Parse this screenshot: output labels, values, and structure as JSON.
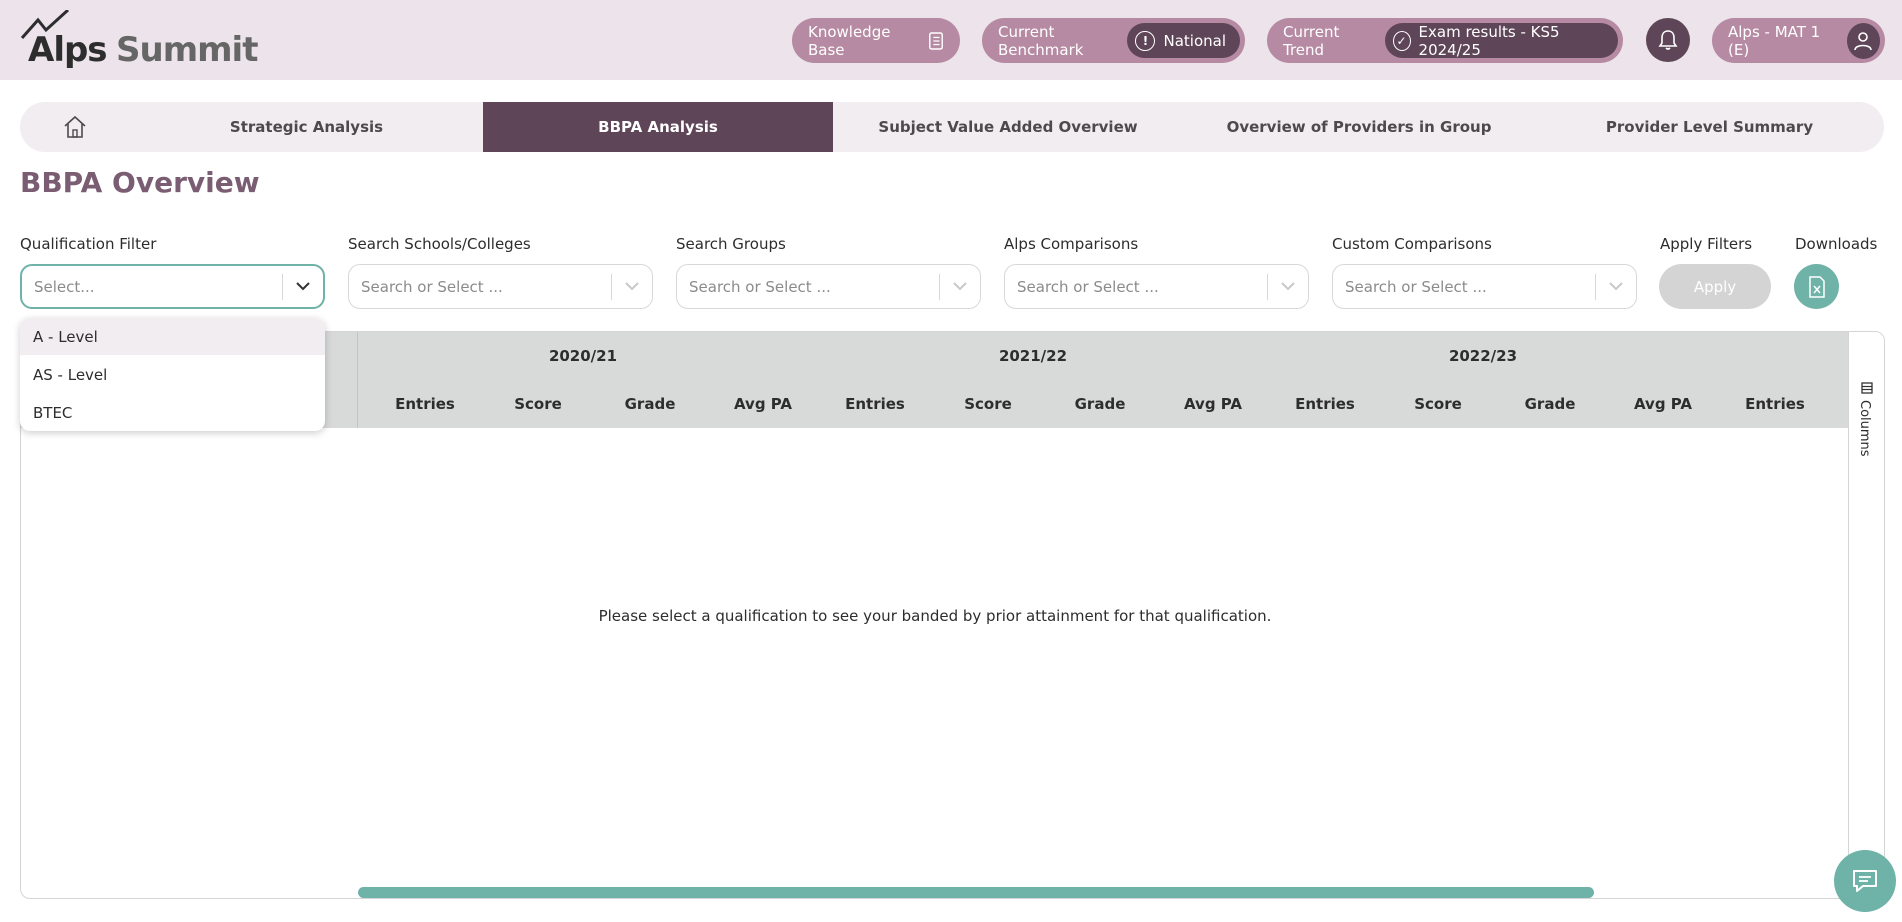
{
  "header": {
    "logo_text_1": "Alps",
    "logo_text_2": "Summit",
    "knowledge_base": "Knowledge Base",
    "benchmark_label": "Current Benchmark",
    "benchmark_value": "National",
    "trend_label": "Current Trend",
    "trend_value": "Exam results - KS5 2024/25",
    "account": "Alps - MAT 1 (E)"
  },
  "nav": {
    "tabs": [
      "Strategic Analysis",
      "BBPA Analysis",
      "Subject Value Added Overview",
      "Overview of Providers in Group",
      "Provider Level Summary"
    ],
    "active": "BBPA Analysis"
  },
  "page": {
    "title": "BBPA Overview"
  },
  "filters": {
    "qualification_label": "Qualification Filter",
    "qualification_placeholder": "Select...",
    "schools_label": "Search Schools/Colleges",
    "groups_label": "Search Groups",
    "alps_label": "Alps Comparisons",
    "custom_label": "Custom Comparisons",
    "search_placeholder": "Search or Select ...",
    "apply_label": "Apply Filters",
    "apply_button": "Apply",
    "downloads_label": "Downloads"
  },
  "dropdown": {
    "options": [
      "A - Level",
      "AS - Level",
      "BTEC"
    ],
    "highlighted": "A - Level"
  },
  "table": {
    "years": [
      "2020/21",
      "2021/22",
      "2022/23"
    ],
    "columns": [
      "Entries",
      "Score",
      "Grade",
      "Avg PA",
      "Entries",
      "Score",
      "Grade",
      "Avg PA",
      "Entries",
      "Score",
      "Grade",
      "Avg PA",
      "Entries"
    ],
    "empty_message": "Please select a qualification to see your banded by prior attainment for that qualification.",
    "columns_panel_label": "Columns"
  },
  "colors": {
    "brand_dark": "#5e4557",
    "brand_pill": "#b58aa2",
    "accent_teal": "#6fb2a8",
    "header_bg": "#ece4ea"
  }
}
